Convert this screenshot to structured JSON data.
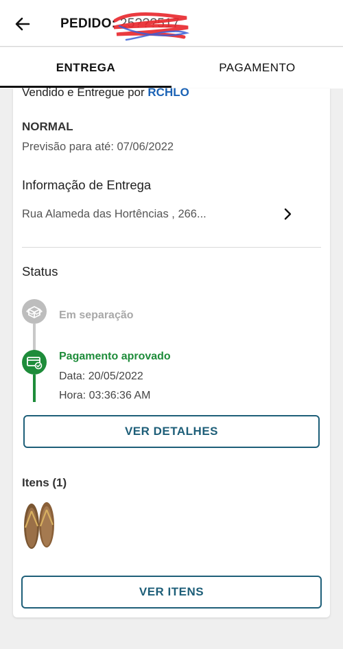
{
  "header": {
    "back_icon": "arrow-left-icon",
    "order_label": "PEDIDO:",
    "order_number": "25???517"
  },
  "tabs": [
    {
      "label": "ENTREGA",
      "active": true
    },
    {
      "label": "PAGAMENTO",
      "active": false
    }
  ],
  "seller": {
    "prefix": "Vendido e Entregue por",
    "name": "RCHLO"
  },
  "shipping": {
    "type": "NORMAL",
    "forecast": "Previsão para até: 07/06/2022"
  },
  "delivery": {
    "title": "Informação de Entrega",
    "address": "Rua Alameda das Hortências , 266..."
  },
  "status": {
    "title": "Status",
    "steps": [
      {
        "label": "Em separação",
        "icon": "box-icon",
        "state": "pending"
      },
      {
        "label": "Pagamento aprovado",
        "icon": "card-check-icon",
        "state": "done",
        "date": "Data: 20/05/2022",
        "time": "Hora: 03:36:36 AM"
      }
    ]
  },
  "buttons": {
    "details": "VER DETALHES",
    "items": "VER ITENS"
  },
  "items": {
    "title": "Itens (1)",
    "thumb_icon": "flip-flop-sandals-image"
  },
  "colors": {
    "accent": "#1d5e78",
    "seller_blue": "#1a62b5",
    "success": "#1e8c3a",
    "pending": "#bdbdbd"
  }
}
